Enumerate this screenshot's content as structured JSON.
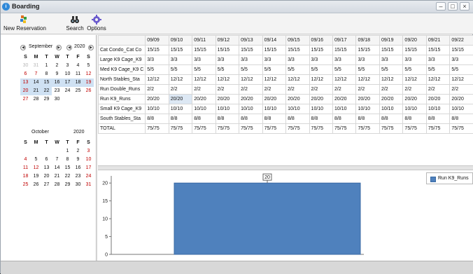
{
  "window": {
    "title": "Boarding",
    "app_icon": "i",
    "minimize": "–",
    "maximize": "□",
    "close": "×"
  },
  "toolbar": {
    "new_reservation": "New Reservation",
    "search": "Search",
    "options": "Options"
  },
  "calendars": [
    {
      "month": "September",
      "year": "2020",
      "weekday_labels": [
        "S",
        "M",
        "T",
        "W",
        "T",
        "F",
        "S"
      ],
      "weeks": [
        [
          [
            "30",
            "muted"
          ],
          [
            "31",
            "muted"
          ],
          [
            "1",
            ""
          ],
          [
            "2",
            ""
          ],
          [
            "3",
            ""
          ],
          [
            "4",
            ""
          ],
          [
            "5",
            ""
          ]
        ],
        [
          [
            "6",
            "red"
          ],
          [
            "7",
            "red"
          ],
          [
            "8",
            ""
          ],
          [
            "9",
            ""
          ],
          [
            "10",
            ""
          ],
          [
            "11",
            ""
          ],
          [
            "12",
            "red"
          ]
        ],
        [
          [
            "13",
            "red sel"
          ],
          [
            "14",
            "sel"
          ],
          [
            "15",
            "sel"
          ],
          [
            "16",
            "sel"
          ],
          [
            "17",
            "sel"
          ],
          [
            "18",
            "sel"
          ],
          [
            "19",
            "red sel"
          ]
        ],
        [
          [
            "20",
            "red sel"
          ],
          [
            "21",
            "sel"
          ],
          [
            "22",
            "sel"
          ],
          [
            "23",
            ""
          ],
          [
            "24",
            ""
          ],
          [
            "25",
            ""
          ],
          [
            "26",
            "red"
          ]
        ],
        [
          [
            "27",
            "red"
          ],
          [
            "28",
            ""
          ],
          [
            "29",
            ""
          ],
          [
            "30",
            ""
          ],
          [
            "",
            ""
          ],
          [
            "",
            ""
          ],
          [
            "",
            ""
          ]
        ]
      ]
    },
    {
      "month": "October",
      "year": "2020",
      "weekday_labels": [
        "S",
        "M",
        "T",
        "W",
        "T",
        "F",
        "S"
      ],
      "weeks": [
        [
          [
            "",
            ""
          ],
          [
            "",
            ""
          ],
          [
            "",
            ""
          ],
          [
            "",
            ""
          ],
          [
            "1",
            ""
          ],
          [
            "2",
            ""
          ],
          [
            "3",
            "red"
          ]
        ],
        [
          [
            "4",
            "red"
          ],
          [
            "5",
            ""
          ],
          [
            "6",
            ""
          ],
          [
            "7",
            ""
          ],
          [
            "8",
            ""
          ],
          [
            "9",
            ""
          ],
          [
            "10",
            "red"
          ]
        ],
        [
          [
            "11",
            "red"
          ],
          [
            "12",
            "red"
          ],
          [
            "13",
            ""
          ],
          [
            "14",
            ""
          ],
          [
            "15",
            ""
          ],
          [
            "16",
            ""
          ],
          [
            "17",
            "red"
          ]
        ],
        [
          [
            "18",
            "red"
          ],
          [
            "19",
            ""
          ],
          [
            "20",
            ""
          ],
          [
            "21",
            ""
          ],
          [
            "22",
            ""
          ],
          [
            "23",
            ""
          ],
          [
            "24",
            "red"
          ]
        ],
        [
          [
            "25",
            "red"
          ],
          [
            "26",
            ""
          ],
          [
            "27",
            ""
          ],
          [
            "28",
            ""
          ],
          [
            "29",
            ""
          ],
          [
            "30",
            ""
          ],
          [
            "31",
            "red"
          ]
        ]
      ]
    }
  ],
  "grid": {
    "columns": [
      "09/09",
      "09/10",
      "09/11",
      "09/12",
      "09/13",
      "09/14",
      "09/15",
      "09/16",
      "09/17",
      "09/18",
      "09/19",
      "09/20",
      "09/21",
      "09/22"
    ],
    "rows": [
      {
        "label": "Cat Condo_Cat Co",
        "values": [
          "15/15",
          "15/15",
          "15/15",
          "15/15",
          "15/15",
          "15/15",
          "15/15",
          "15/15",
          "15/15",
          "15/15",
          "15/15",
          "15/15",
          "15/15",
          "15/15"
        ]
      },
      {
        "label": "Large K9 Cage_K9",
        "values": [
          "3/3",
          "3/3",
          "3/3",
          "3/3",
          "3/3",
          "3/3",
          "3/3",
          "3/3",
          "3/3",
          "3/3",
          "3/3",
          "3/3",
          "3/3",
          "3/3"
        ]
      },
      {
        "label": "Med K9 Cage_K9 C",
        "values": [
          "5/5",
          "5/5",
          "5/5",
          "5/5",
          "5/5",
          "5/5",
          "5/5",
          "5/5",
          "5/5",
          "5/5",
          "5/5",
          "5/5",
          "5/5",
          "5/5"
        ]
      },
      {
        "label": "North Stables_Sta",
        "values": [
          "12/12",
          "12/12",
          "12/12",
          "12/12",
          "12/12",
          "12/12",
          "12/12",
          "12/12",
          "12/12",
          "12/12",
          "12/12",
          "12/12",
          "12/12",
          "12/12"
        ]
      },
      {
        "label": "Run Double_Runs",
        "values": [
          "2/2",
          "2/2",
          "2/2",
          "2/2",
          "2/2",
          "2/2",
          "2/2",
          "2/2",
          "2/2",
          "2/2",
          "2/2",
          "2/2",
          "2/2",
          "2/2"
        ]
      },
      {
        "label": "Run K9_Runs",
        "values": [
          "20/20",
          "20/20",
          "20/20",
          "20/20",
          "20/20",
          "20/20",
          "20/20",
          "20/20",
          "20/20",
          "20/20",
          "20/20",
          "20/20",
          "20/20",
          "20/20"
        ]
      },
      {
        "label": "Small K9 Cage_K9",
        "values": [
          "10/10",
          "10/10",
          "10/10",
          "10/10",
          "10/10",
          "10/10",
          "10/10",
          "10/10",
          "10/10",
          "10/10",
          "10/10",
          "10/10",
          "10/10",
          "10/10"
        ]
      },
      {
        "label": "South Stables_Sta",
        "values": [
          "8/8",
          "8/8",
          "8/8",
          "8/8",
          "8/8",
          "8/8",
          "8/8",
          "8/8",
          "8/8",
          "8/8",
          "8/8",
          "8/8",
          "8/8",
          "8/8"
        ]
      },
      {
        "label": "TOTAL",
        "values": [
          "75/75",
          "75/75",
          "75/75",
          "75/75",
          "75/75",
          "75/75",
          "75/75",
          "75/75",
          "75/75",
          "75/75",
          "75/75",
          "75/75",
          "75/75",
          "75/75"
        ]
      }
    ],
    "selected_cell": {
      "row": 5,
      "col": 1
    }
  },
  "chart_data": {
    "type": "bar",
    "categories": [
      ""
    ],
    "series": [
      {
        "name": "Run K9_Runs",
        "values": [
          20
        ],
        "color": "#4f81bd"
      }
    ],
    "ylim": [
      0,
      22
    ],
    "yticks": [
      0,
      5,
      10,
      15,
      20
    ],
    "data_labels": [
      "20"
    ],
    "grid": false,
    "legend": "top-right"
  },
  "colors": {
    "accent": "#2f89d9",
    "bar": "#4f81bd",
    "weekend": "#c00000"
  }
}
